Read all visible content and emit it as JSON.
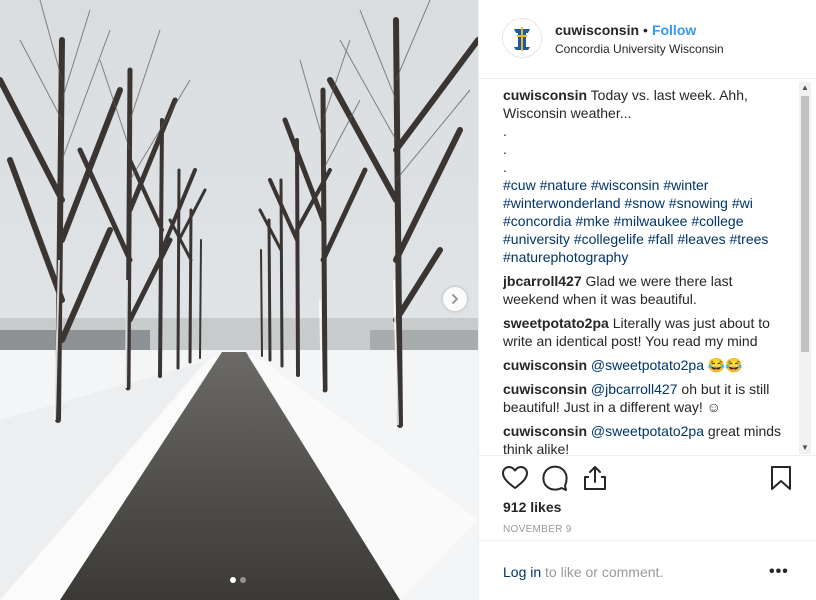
{
  "post": {
    "image_alt": "Snowy tree-lined path",
    "carousel": {
      "total": 2,
      "active_index": 0
    }
  },
  "header": {
    "username": "cuwisconsin",
    "separator": "•",
    "follow_label": "Follow",
    "location": "Concordia University Wisconsin"
  },
  "caption": {
    "username": "cuwisconsin",
    "text": "Today vs. last week. Ahh, Wisconsin weather...",
    "dots": [
      ".",
      ".",
      "."
    ],
    "hashtags": [
      "#cuw",
      "#nature",
      "#wisconsin",
      "#winter",
      "#winterwonderland",
      "#snow",
      "#snowing",
      "#wi",
      "#concordia",
      "#mke",
      "#milwaukee",
      "#college",
      "#university",
      "#collegelife",
      "#fall",
      "#leaves",
      "#trees",
      "#naturephotography"
    ]
  },
  "comments": [
    {
      "username": "jbcarroll427",
      "mention": "",
      "text": "Glad we were there last weekend when it was beautiful."
    },
    {
      "username": "sweetpotato2pa",
      "mention": "",
      "text": "Literally was just about to write an identical post! You read my mind"
    },
    {
      "username": "cuwisconsin",
      "mention": "@sweetpotato2pa",
      "text": "😂😂"
    },
    {
      "username": "cuwisconsin",
      "mention": "@jbcarroll427",
      "text": "oh but it is still beautiful! Just in a different way! ☺"
    },
    {
      "username": "cuwisconsin",
      "mention": "@sweetpotato2pa",
      "text": "great minds think alike!"
    }
  ],
  "stats": {
    "likes": "912 likes",
    "date": "NOVEMBER 9"
  },
  "footer": {
    "login_label": "Log in",
    "login_suffix": " to like or comment.",
    "more_label": "•••"
  },
  "icons": {
    "like": "heart-icon",
    "comment": "comment-icon",
    "share": "share-icon",
    "save": "bookmark-icon",
    "next": "chevron-right-icon"
  },
  "colors": {
    "link": "#003569",
    "follow": "#3897f0",
    "muted": "#999999"
  }
}
